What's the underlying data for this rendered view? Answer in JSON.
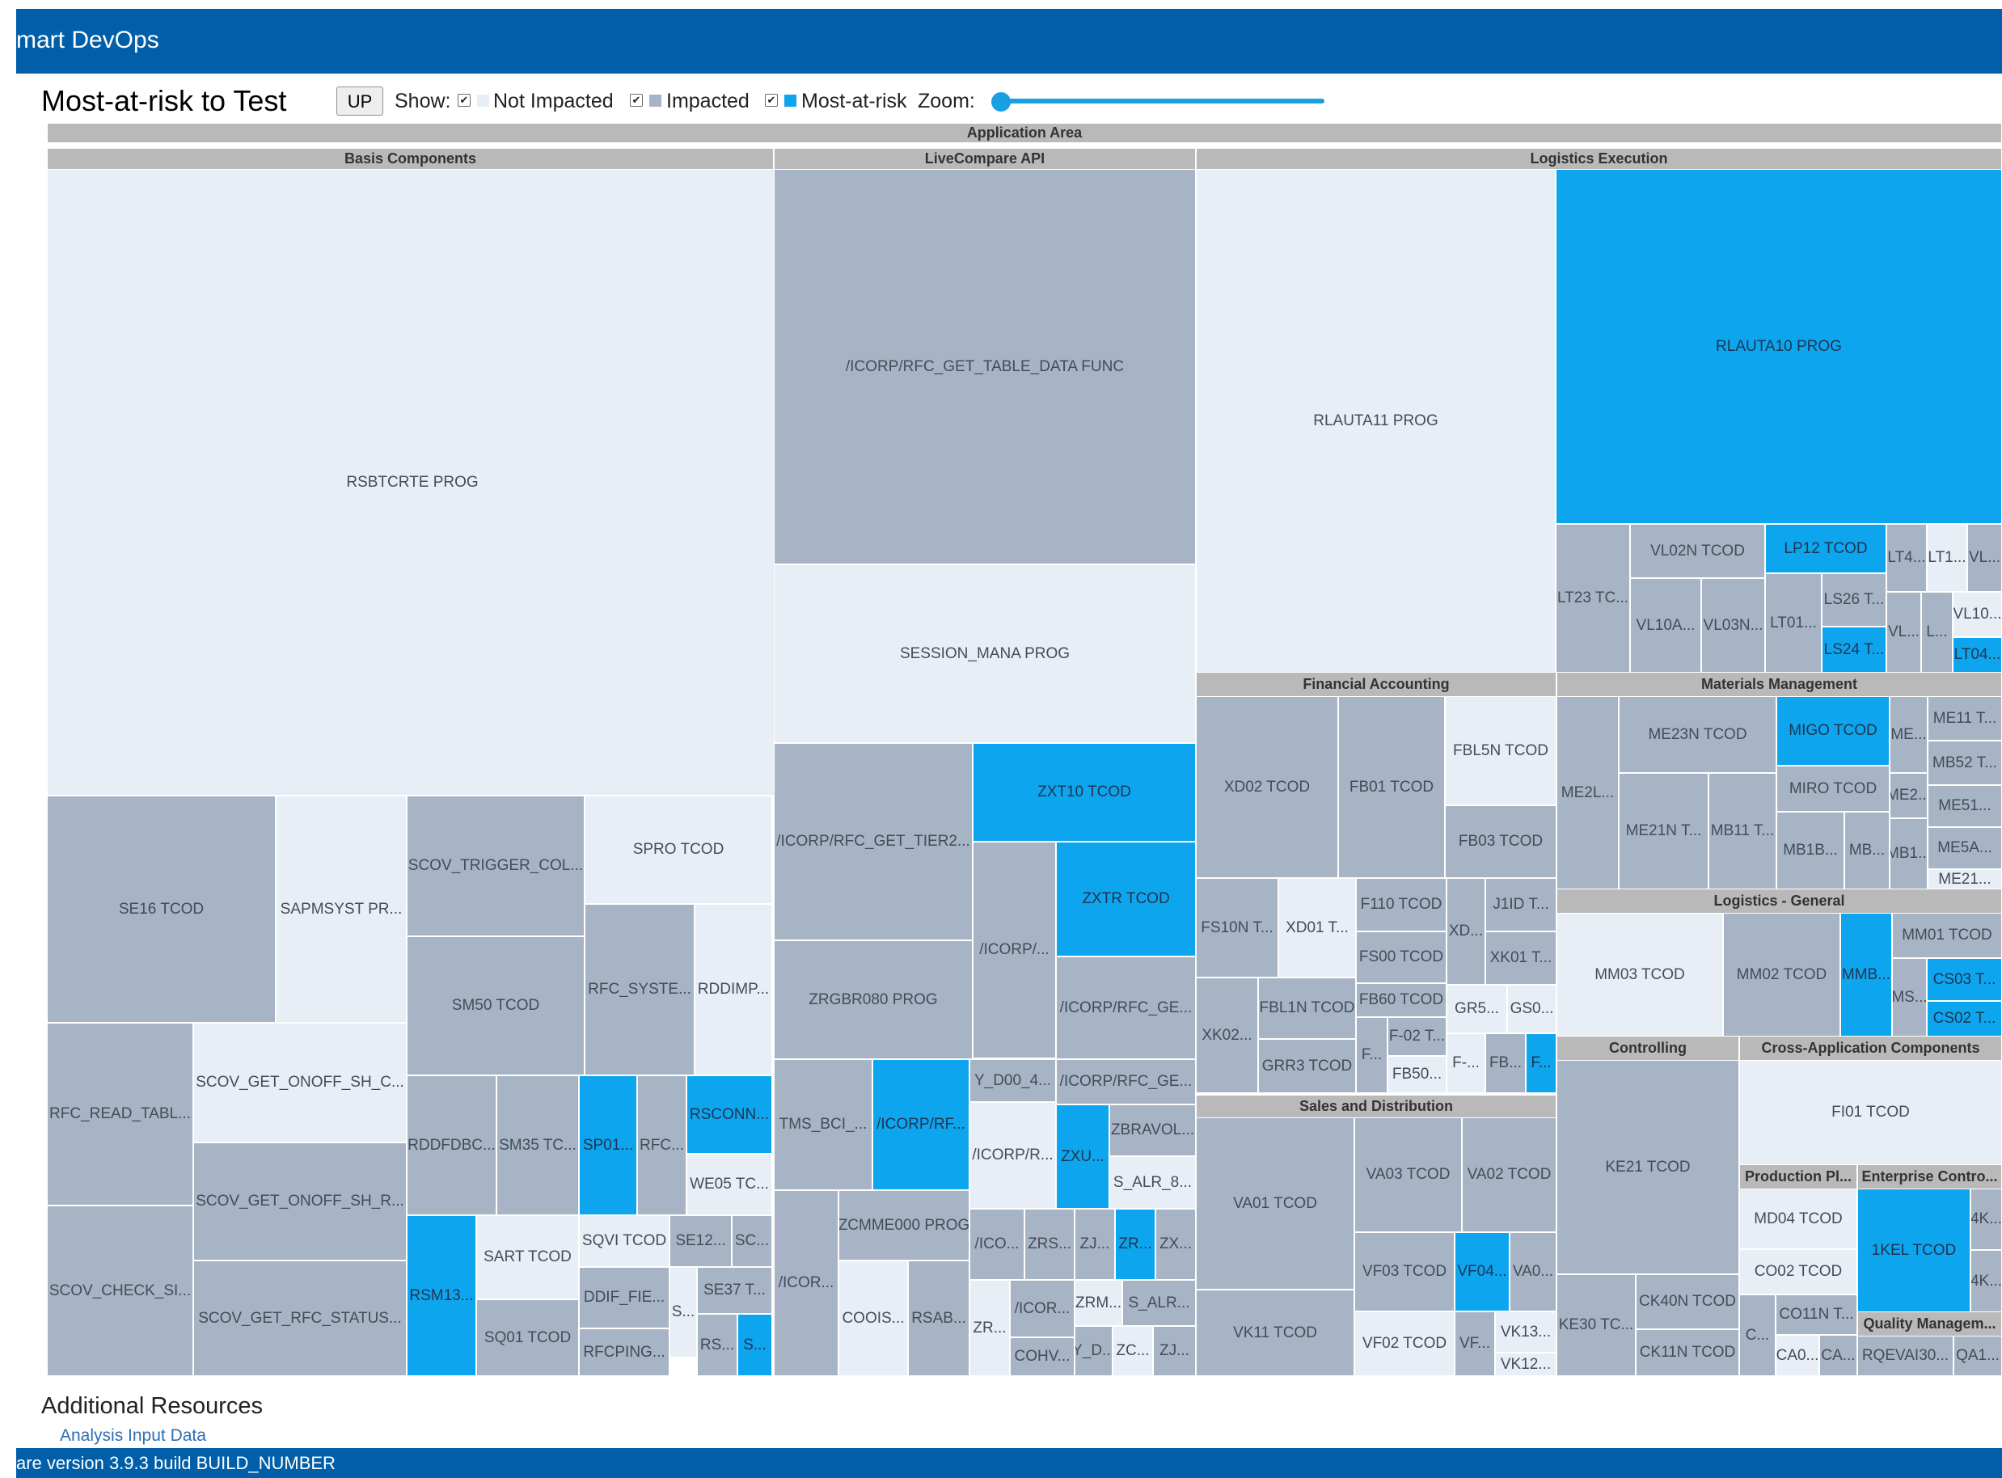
{
  "app": {
    "title": "mart DevOps",
    "footer": "are version 3.9.3 build BUILD_NUMBER"
  },
  "toolbar": {
    "title": "Most-at-risk to Test",
    "up_label": "UP",
    "show_label": "Show:",
    "legend": [
      {
        "label": "Not Impacted",
        "checked": true,
        "color": "#e8eef5"
      },
      {
        "label": "Impacted",
        "checked": true,
        "color": "#a6b4c5"
      },
      {
        "label": "Most-at-risk",
        "checked": true,
        "color": "#0ea5ef"
      }
    ],
    "zoom_label": "Zoom:",
    "zoom_value": 0
  },
  "resources": {
    "heading": "Additional Resources",
    "link": "Analysis Input Data"
  },
  "colors": {
    "not_impacted": "#e8eef5",
    "impacted": "#a6b4c5",
    "most_at_risk": "#0ea5ef",
    "header": "#b9b9b9",
    "bar": "#005fa8"
  },
  "treemap": {
    "root": "Application Area",
    "groups": [
      {
        "name": "Basis Components",
        "items": [
          {
            "label": "RSBTCRTE PROG",
            "status": "not_impacted"
          },
          {
            "label": "SE16 TCOD",
            "status": "impacted"
          },
          {
            "label": "SAPMSYST PR...",
            "status": "not_impacted"
          },
          {
            "label": "SCOV_TRIGGER_COL...",
            "status": "impacted"
          },
          {
            "label": "SPRO TCOD",
            "status": "not_impacted"
          },
          {
            "label": "SM50 TCOD",
            "status": "impacted"
          },
          {
            "label": "RFC_SYSTE...",
            "status": "impacted"
          },
          {
            "label": "RDDIMP...",
            "status": "not_impacted"
          },
          {
            "label": "RFC_READ_TABL...",
            "status": "impacted"
          },
          {
            "label": "SCOV_GET_ONOFF_SH_C...",
            "status": "not_impacted"
          },
          {
            "label": "SCOV_GET_ONOFF_SH_R...",
            "status": "impacted"
          },
          {
            "label": "SCOV_CHECK_SI...",
            "status": "impacted"
          },
          {
            "label": "SCOV_GET_RFC_STATUS...",
            "status": "impacted"
          },
          {
            "label": "RDDFDBC...",
            "status": "impacted"
          },
          {
            "label": "SM35 TC...",
            "status": "impacted"
          },
          {
            "label": "SP01...",
            "status": "most_at_risk"
          },
          {
            "label": "RFC...",
            "status": "impacted"
          },
          {
            "label": "RSCONN...",
            "status": "most_at_risk"
          },
          {
            "label": "WE05 TC...",
            "status": "not_impacted"
          },
          {
            "label": "RSM13...",
            "status": "most_at_risk"
          },
          {
            "label": "SART TCOD",
            "status": "not_impacted"
          },
          {
            "label": "SQ01 TCOD",
            "status": "impacted"
          },
          {
            "label": "SQVI TCOD",
            "status": "not_impacted"
          },
          {
            "label": "SE12...",
            "status": "impacted"
          },
          {
            "label": "SC...",
            "status": "impacted"
          },
          {
            "label": "DDIF_FIE...",
            "status": "impacted"
          },
          {
            "label": "S...",
            "status": "not_impacted"
          },
          {
            "label": "SE37 T...",
            "status": "impacted"
          },
          {
            "label": "RFCPING...",
            "status": "impacted"
          },
          {
            "label": "RS...",
            "status": "impacted"
          },
          {
            "label": "S...",
            "status": "most_at_risk"
          }
        ]
      },
      {
        "name": "LiveCompare API",
        "items": [
          {
            "label": "/ICORP/RFC_GET_TABLE_DATA FUNC",
            "status": "impacted"
          },
          {
            "label": "SESSION_MANA PROG",
            "status": "not_impacted"
          },
          {
            "label": "/ICORP/RFC_GET_TIER2...",
            "status": "impacted"
          },
          {
            "label": "ZXT10 TCOD",
            "status": "most_at_risk"
          },
          {
            "label": "/ICORP/...",
            "status": "impacted"
          },
          {
            "label": "ZXTR TCOD",
            "status": "most_at_risk"
          },
          {
            "label": "ZRGBR080 PROG",
            "status": "impacted"
          },
          {
            "label": "/ICORP/RFC_GE...",
            "status": "impacted"
          },
          {
            "label": "/ICORP/RFC_GE...",
            "status": "impacted"
          },
          {
            "label": "TMS_BCI_...",
            "status": "impacted"
          },
          {
            "label": "/ICORP/RF...",
            "status": "most_at_risk"
          },
          {
            "label": "Y_D00_4...",
            "status": "impacted"
          },
          {
            "label": "ZXU...",
            "status": "most_at_risk"
          },
          {
            "label": "ZBRAVOL...",
            "status": "impacted"
          },
          {
            "label": "/ICORP/R...",
            "status": "not_impacted"
          },
          {
            "label": "S_ALR_8...",
            "status": "not_impacted"
          },
          {
            "label": "/ICOR...",
            "status": "impacted"
          },
          {
            "label": "ZCMME000 PROG",
            "status": "impacted"
          },
          {
            "label": "COOIS...",
            "status": "not_impacted"
          },
          {
            "label": "RSAB...",
            "status": "impacted"
          },
          {
            "label": "/ICO...",
            "status": "impacted"
          },
          {
            "label": "ZRS...",
            "status": "impacted"
          },
          {
            "label": "ZJ...",
            "status": "impacted"
          },
          {
            "label": "ZR...",
            "status": "most_at_risk"
          },
          {
            "label": "ZX...",
            "status": "impacted"
          },
          {
            "label": "ZR...",
            "status": "not_impacted"
          },
          {
            "label": "/ICOR...",
            "status": "impacted"
          },
          {
            "label": "ZRM...",
            "status": "not_impacted"
          },
          {
            "label": "S_ALR...",
            "status": "impacted"
          },
          {
            "label": "COHV...",
            "status": "impacted"
          },
          {
            "label": "Y_D...",
            "status": "impacted"
          },
          {
            "label": "ZC...",
            "status": "not_impacted"
          },
          {
            "label": "ZJ...",
            "status": "impacted"
          }
        ]
      },
      {
        "name": "Logistics Execution",
        "items": [
          {
            "label": "RLAUTA11 PROG",
            "status": "not_impacted"
          },
          {
            "label": "RLAUTA10 PROG",
            "status": "most_at_risk"
          },
          {
            "label": "LT23 TC...",
            "status": "impacted"
          },
          {
            "label": "VL02N TCOD",
            "status": "impacted"
          },
          {
            "label": "LP12 TCOD",
            "status": "most_at_risk"
          },
          {
            "label": "LT4...",
            "status": "impacted"
          },
          {
            "label": "LT1...",
            "status": "not_impacted"
          },
          {
            "label": "VL...",
            "status": "impacted"
          },
          {
            "label": "VL10A...",
            "status": "impacted"
          },
          {
            "label": "VL03N...",
            "status": "impacted"
          },
          {
            "label": "LT01...",
            "status": "impacted"
          },
          {
            "label": "LS26 T...",
            "status": "impacted"
          },
          {
            "label": "LS24 T...",
            "status": "most_at_risk"
          },
          {
            "label": "VL...",
            "status": "impacted"
          },
          {
            "label": "L...",
            "status": "impacted"
          },
          {
            "label": "VL10...",
            "status": "not_impacted"
          },
          {
            "label": "LT04...",
            "status": "most_at_risk"
          }
        ]
      },
      {
        "name": "Financial Accounting",
        "items": [
          {
            "label": "XD02 TCOD",
            "status": "impacted"
          },
          {
            "label": "FB01 TCOD",
            "status": "impacted"
          },
          {
            "label": "FBL5N TCOD",
            "status": "not_impacted"
          },
          {
            "label": "FB03 TCOD",
            "status": "impacted"
          },
          {
            "label": "FS10N T...",
            "status": "impacted"
          },
          {
            "label": "XD01 T...",
            "status": "not_impacted"
          },
          {
            "label": "F110 TCOD",
            "status": "impacted"
          },
          {
            "label": "XD...",
            "status": "impacted"
          },
          {
            "label": "J1ID T...",
            "status": "impacted"
          },
          {
            "label": "FS00 TCOD",
            "status": "impacted"
          },
          {
            "label": "XK01 T...",
            "status": "impacted"
          },
          {
            "label": "XK02...",
            "status": "impacted"
          },
          {
            "label": "FBL1N TCOD",
            "status": "impacted"
          },
          {
            "label": "FB60 TCOD",
            "status": "impacted"
          },
          {
            "label": "GR5...",
            "status": "not_impacted"
          },
          {
            "label": "GS0...",
            "status": "not_impacted"
          },
          {
            "label": "GRR3 TCOD",
            "status": "impacted"
          },
          {
            "label": "F-02 T...",
            "status": "impacted"
          },
          {
            "label": "F...",
            "status": "impacted"
          },
          {
            "label": "FB50...",
            "status": "not_impacted"
          },
          {
            "label": "F-...",
            "status": "not_impacted"
          },
          {
            "label": "FB...",
            "status": "impacted"
          },
          {
            "label": "F...",
            "status": "most_at_risk"
          }
        ]
      },
      {
        "name": "Sales and Distribution",
        "items": [
          {
            "label": "VA01 TCOD",
            "status": "impacted"
          },
          {
            "label": "VA03 TCOD",
            "status": "impacted"
          },
          {
            "label": "VA02 TCOD",
            "status": "impacted"
          },
          {
            "label": "VK11 TCOD",
            "status": "impacted"
          },
          {
            "label": "VF03 TCOD",
            "status": "impacted"
          },
          {
            "label": "VF04...",
            "status": "most_at_risk"
          },
          {
            "label": "VA0...",
            "status": "impacted"
          },
          {
            "label": "VF02 TCOD",
            "status": "not_impacted"
          },
          {
            "label": "VF...",
            "status": "impacted"
          },
          {
            "label": "VK13...",
            "status": "not_impacted"
          },
          {
            "label": "VK12...",
            "status": "not_impacted"
          }
        ]
      },
      {
        "name": "Materials Management",
        "items": [
          {
            "label": "ME2L...",
            "status": "impacted"
          },
          {
            "label": "ME23N TCOD",
            "status": "impacted"
          },
          {
            "label": "MIGO TCOD",
            "status": "most_at_risk"
          },
          {
            "label": "ME...",
            "status": "impacted"
          },
          {
            "label": "ME11 T...",
            "status": "impacted"
          },
          {
            "label": "MB52 T...",
            "status": "impacted"
          },
          {
            "label": "MIRO TCOD",
            "status": "impacted"
          },
          {
            "label": "ME2...",
            "status": "impacted"
          },
          {
            "label": "ME51...",
            "status": "impacted"
          },
          {
            "label": "ME21N T...",
            "status": "impacted"
          },
          {
            "label": "MB11 T...",
            "status": "impacted"
          },
          {
            "label": "MB1B...",
            "status": "impacted"
          },
          {
            "label": "MB...",
            "status": "impacted"
          },
          {
            "label": "ME5A...",
            "status": "impacted"
          },
          {
            "label": "MB1...",
            "status": "impacted"
          },
          {
            "label": "ME21...",
            "status": "not_impacted"
          }
        ]
      },
      {
        "name": "Logistics - General",
        "items": [
          {
            "label": "MM03 TCOD",
            "status": "not_impacted"
          },
          {
            "label": "MM02 TCOD",
            "status": "impacted"
          },
          {
            "label": "MMB...",
            "status": "most_at_risk"
          },
          {
            "label": "MM01 TCOD",
            "status": "impacted"
          },
          {
            "label": "MS...",
            "status": "impacted"
          },
          {
            "label": "CS03 T...",
            "status": "most_at_risk"
          },
          {
            "label": "CS02 T...",
            "status": "most_at_risk"
          }
        ]
      },
      {
        "name": "Controlling",
        "items": [
          {
            "label": "KE21 TCOD",
            "status": "impacted"
          },
          {
            "label": "KE30 TC...",
            "status": "impacted"
          },
          {
            "label": "CK40N TCOD",
            "status": "impacted"
          },
          {
            "label": "CK11N TCOD",
            "status": "impacted"
          }
        ]
      },
      {
        "name": "Cross-Application Components",
        "items": [
          {
            "label": "FI01 TCOD",
            "status": "not_impacted"
          }
        ]
      },
      {
        "name": "Production Pl...",
        "items": [
          {
            "label": "MD04 TCOD",
            "status": "not_impacted"
          },
          {
            "label": "CO02 TCOD",
            "status": "not_impacted"
          },
          {
            "label": "C...",
            "status": "impacted"
          },
          {
            "label": "CO11N T...",
            "status": "impacted"
          },
          {
            "label": "CA0...",
            "status": "not_impacted"
          },
          {
            "label": "CA...",
            "status": "impacted"
          }
        ]
      },
      {
        "name": "Enterprise Contro...",
        "items": [
          {
            "label": "1KEL TCOD",
            "status": "most_at_risk"
          },
          {
            "label": "4K...",
            "status": "impacted"
          },
          {
            "label": "4K...",
            "status": "impacted"
          }
        ]
      },
      {
        "name": "Quality Managem...",
        "items": [
          {
            "label": "RQEVAI30...",
            "status": "impacted"
          },
          {
            "label": "QA1...",
            "status": "impacted"
          }
        ]
      }
    ]
  }
}
